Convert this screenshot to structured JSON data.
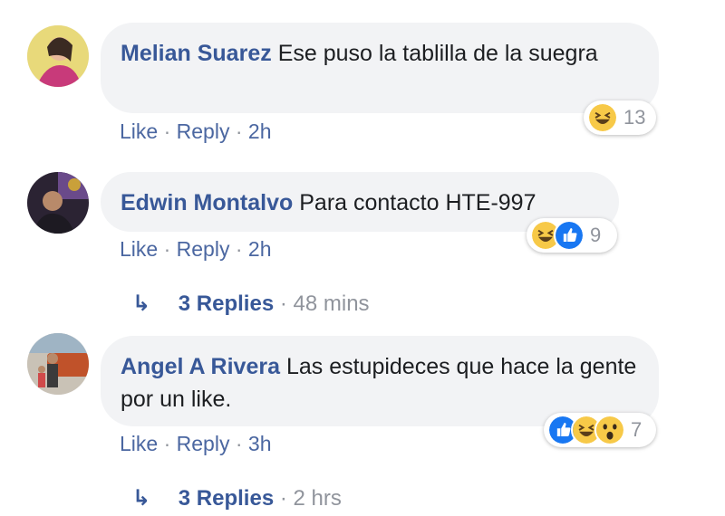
{
  "comments": [
    {
      "author": "Melian Suarez",
      "text": "Ese puso la tablilla de la suegra",
      "actions": {
        "like": "Like",
        "reply": "Reply",
        "time": "2h"
      },
      "reactions": {
        "icons": [
          "haha-icon"
        ],
        "count": "13"
      }
    },
    {
      "author": "Edwin Montalvo",
      "text": "Para contacto HTE-997",
      "actions": {
        "like": "Like",
        "reply": "Reply",
        "time": "2h"
      },
      "reactions": {
        "icons": [
          "haha-icon",
          "like-icon"
        ],
        "count": "9"
      },
      "replies": {
        "label": "3 Replies",
        "time": "48 mins"
      }
    },
    {
      "author": "Angel A Rivera",
      "text": "Las estupideces que hace la gente por un like.",
      "actions": {
        "like": "Like",
        "reply": "Reply",
        "time": "3h"
      },
      "reactions": {
        "icons": [
          "like-icon",
          "haha-icon",
          "wow-icon"
        ],
        "count": "7"
      },
      "replies": {
        "label": "3 Replies",
        "time": "2 hrs"
      }
    }
  ],
  "separator": "·",
  "colors": {
    "author": "#385898",
    "link": "#4b67a1",
    "meta": "#90949c",
    "bubble": "#f2f3f5",
    "like": "#1877f2",
    "emoji": "#f7c948"
  }
}
